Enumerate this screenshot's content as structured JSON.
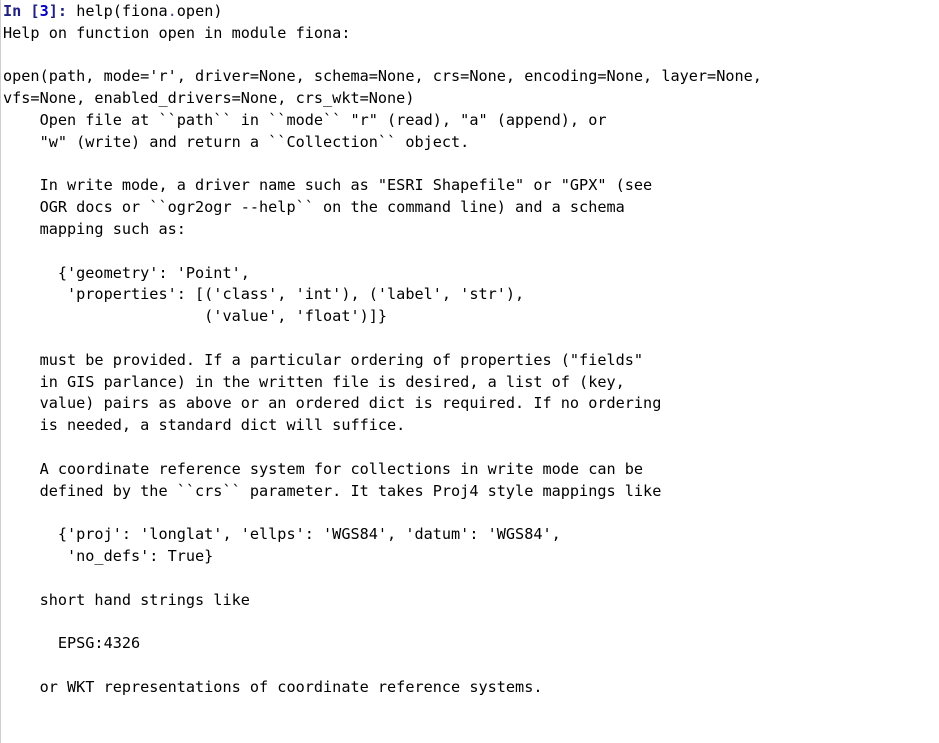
{
  "cell": {
    "kind": "ipython-output-cell",
    "background_color": "#ffffff",
    "text_color": "#000000",
    "prompt_color": "#202080",
    "prompt_number_color": "#0000c0",
    "left_rule_color": "#cfcfcf"
  },
  "prompt": {
    "label_open": "In [",
    "number": "3",
    "label_close": "]:",
    "full": "In [3]:"
  },
  "input": {
    "expression": "help(fiona.open)",
    "callee": "help(fiona",
    "separator": ".",
    "argument_tail": "open)"
  },
  "output": {
    "lines": [
      "Help on function open in module fiona:",
      "",
      "open(path, mode='r', driver=None, schema=None, crs=None, encoding=None, layer=None,",
      "vfs=None, enabled_drivers=None, crs_wkt=None)",
      "    Open file at ``path`` in ``mode`` \"r\" (read), \"a\" (append), or",
      "    \"w\" (write) and return a ``Collection`` object.",
      "",
      "    In write mode, a driver name such as \"ESRI Shapefile\" or \"GPX\" (see",
      "    OGR docs or ``ogr2ogr --help`` on the command line) and a schema",
      "    mapping such as:",
      "",
      "      {'geometry': 'Point',",
      "       'properties': [('class', 'int'), ('label', 'str'),",
      "                      ('value', 'float')]}",
      "",
      "    must be provided. If a particular ordering of properties (\"fields\"",
      "    in GIS parlance) in the written file is desired, a list of (key,",
      "    value) pairs as above or an ordered dict is required. If no ordering",
      "    is needed, a standard dict will suffice.",
      "",
      "    A coordinate reference system for collections in write mode can be",
      "    defined by the ``crs`` parameter. It takes Proj4 style mappings like",
      "",
      "      {'proj': 'longlat', 'ellps': 'WGS84', 'datum': 'WGS84',",
      "       'no_defs': True}",
      "",
      "    short hand strings like",
      "",
      "      EPSG:4326",
      "",
      "    or WKT representations of coordinate reference systems."
    ]
  }
}
